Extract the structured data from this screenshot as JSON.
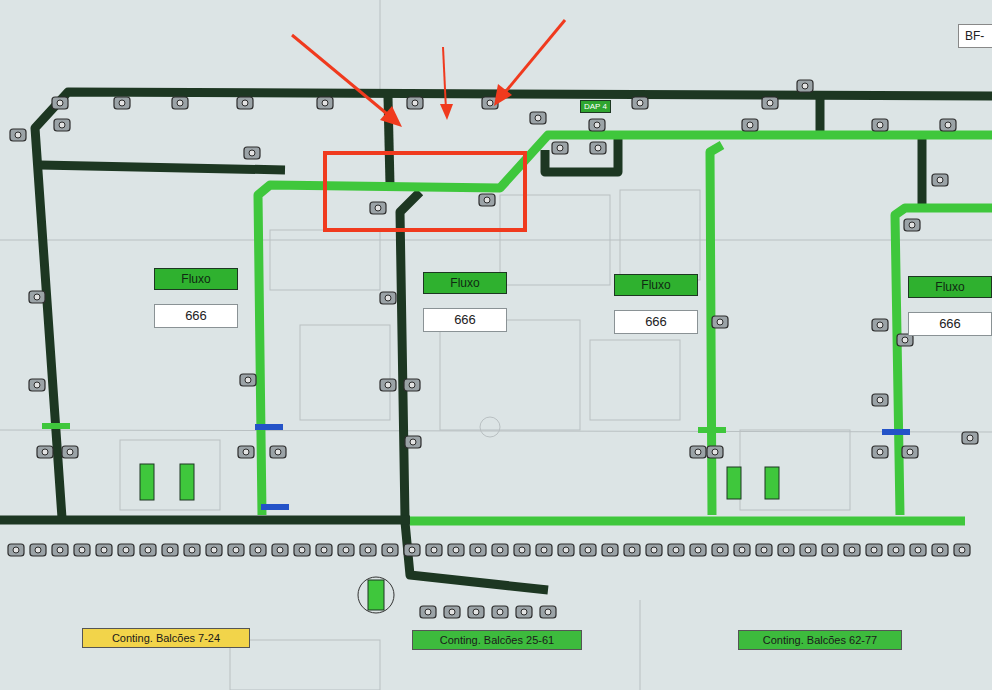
{
  "header": {
    "label": "BF-"
  },
  "tag": {
    "label": "DAP 4"
  },
  "flow_panels": [
    {
      "label": "Fluxo",
      "value": "666"
    },
    {
      "label": "Fluxo",
      "value": "666"
    },
    {
      "label": "Fluxo",
      "value": "666"
    },
    {
      "label": "Fluxo",
      "value": "666"
    }
  ],
  "counters": [
    {
      "label": "Conting. Balcões 7-24",
      "color": "#f2d44a"
    },
    {
      "label": "Conting. Balcões 25-61",
      "color": "#3dbb3d"
    },
    {
      "label": "Conting. Balcões 62-77",
      "color": "#3dbb3d"
    }
  ],
  "conveyors": [
    {
      "running": false
    },
    {
      "running": false
    },
    {
      "running": false
    },
    {
      "running": false
    },
    {
      "running": false
    },
    {
      "running": false
    },
    {
      "running": false
    },
    {
      "running": false
    },
    {
      "running": false
    },
    {
      "running": true
    },
    {
      "running": true
    },
    {
      "running": true
    },
    {
      "running": true
    }
  ]
}
